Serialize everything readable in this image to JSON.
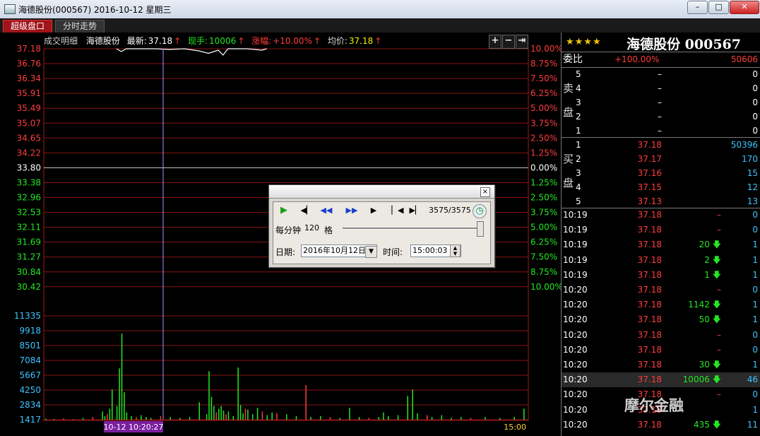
{
  "window": {
    "title": "海德股份(000567) 2016-10-12 星期三",
    "minimize": "–",
    "maximize": "□",
    "close": "✕"
  },
  "tabs": [
    {
      "label": "超级盘口"
    },
    {
      "label": "分时走势"
    }
  ],
  "infobar": {
    "detail": "成交明细",
    "name": "海德股份",
    "latest_label": "最新:",
    "latest": "37.18",
    "hand_label": "现手:",
    "hand": "10006",
    "change_label": "涨幅:",
    "change": "+10.00%",
    "avg_label": "均价:",
    "avg": "37.18"
  },
  "chart_tools": [
    "+",
    "−",
    "⇥"
  ],
  "chart_data": {
    "type": "line",
    "price_ticks": [
      {
        "v": "37.18",
        "pct": "10.00%",
        "side": "up"
      },
      {
        "v": "36.76",
        "pct": "8.75%",
        "side": "up"
      },
      {
        "v": "36.34",
        "pct": "7.50%",
        "side": "up"
      },
      {
        "v": "35.91",
        "pct": "6.25%",
        "side": "up"
      },
      {
        "v": "35.49",
        "pct": "5.00%",
        "side": "up"
      },
      {
        "v": "35.07",
        "pct": "3.75%",
        "side": "up"
      },
      {
        "v": "34.65",
        "pct": "2.50%",
        "side": "up"
      },
      {
        "v": "34.22",
        "pct": "1.25%",
        "side": "up"
      },
      {
        "v": "33.80",
        "pct": "0.00%",
        "side": "mid"
      },
      {
        "v": "33.38",
        "pct": "1.25%",
        "side": "down"
      },
      {
        "v": "32.96",
        "pct": "2.50%",
        "side": "down"
      },
      {
        "v": "32.53",
        "pct": "3.75%",
        "side": "down"
      },
      {
        "v": "32.11",
        "pct": "5.00%",
        "side": "down"
      },
      {
        "v": "31.69",
        "pct": "6.25%",
        "side": "down"
      },
      {
        "v": "31.27",
        "pct": "7.50%",
        "side": "down"
      },
      {
        "v": "30.84",
        "pct": "8.75%",
        "side": "down"
      },
      {
        "v": "30.42",
        "pct": "10.00%",
        "side": "down"
      }
    ],
    "volume_ticks": [
      "11335",
      "9918",
      "8501",
      "7084",
      "5667",
      "4250",
      "2834",
      "1417"
    ],
    "time_start": "10-12 10:20:27",
    "time_end": "15:00",
    "volume_bars": [
      [
        0.003,
        120,
        "g"
      ],
      [
        0.02,
        80,
        "g"
      ],
      [
        0.04,
        150,
        "r"
      ],
      [
        0.06,
        60,
        "g"
      ],
      [
        0.08,
        200,
        "g"
      ],
      [
        0.1,
        300,
        "r"
      ],
      [
        0.12,
        900,
        "g"
      ],
      [
        0.125,
        400,
        "g"
      ],
      [
        0.13,
        600,
        "r"
      ],
      [
        0.135,
        1200,
        "g"
      ],
      [
        0.14,
        3300,
        "g"
      ],
      [
        0.15,
        1500,
        "g"
      ],
      [
        0.155,
        5600,
        "g"
      ],
      [
        0.16,
        9400,
        "g"
      ],
      [
        0.165,
        3000,
        "g"
      ],
      [
        0.17,
        800,
        "g"
      ],
      [
        0.18,
        400,
        "g"
      ],
      [
        0.19,
        300,
        "r"
      ],
      [
        0.2,
        500,
        "g"
      ],
      [
        0.21,
        300,
        "g"
      ],
      [
        0.22,
        200,
        "g"
      ],
      [
        0.24,
        400,
        "r"
      ],
      [
        0.26,
        300,
        "g"
      ],
      [
        0.28,
        200,
        "g"
      ],
      [
        0.3,
        300,
        "g"
      ],
      [
        0.32,
        1900,
        "g"
      ],
      [
        0.335,
        600,
        "g"
      ],
      [
        0.34,
        5300,
        "g"
      ],
      [
        0.345,
        2500,
        "g"
      ],
      [
        0.35,
        1500,
        "g"
      ],
      [
        0.355,
        800,
        "r"
      ],
      [
        0.36,
        1200,
        "g"
      ],
      [
        0.365,
        1500,
        "g"
      ],
      [
        0.37,
        1000,
        "g"
      ],
      [
        0.375,
        600,
        "r"
      ],
      [
        0.38,
        900,
        "g"
      ],
      [
        0.39,
        400,
        "g"
      ],
      [
        0.4,
        5700,
        "g"
      ],
      [
        0.405,
        1600,
        "g"
      ],
      [
        0.41,
        700,
        "g"
      ],
      [
        0.415,
        1200,
        "r"
      ],
      [
        0.42,
        1100,
        "g"
      ],
      [
        0.43,
        600,
        "g"
      ],
      [
        0.44,
        1300,
        "g"
      ],
      [
        0.45,
        900,
        "r"
      ],
      [
        0.46,
        500,
        "g"
      ],
      [
        0.47,
        800,
        "g"
      ],
      [
        0.48,
        700,
        "r"
      ],
      [
        0.5,
        600,
        "g"
      ],
      [
        0.52,
        400,
        "g"
      ],
      [
        0.54,
        3800,
        "r"
      ],
      [
        0.55,
        300,
        "g"
      ],
      [
        0.57,
        400,
        "g"
      ],
      [
        0.59,
        300,
        "r"
      ],
      [
        0.61,
        200,
        "g"
      ],
      [
        0.63,
        1300,
        "g"
      ],
      [
        0.65,
        300,
        "g"
      ],
      [
        0.67,
        200,
        "r"
      ],
      [
        0.69,
        300,
        "g"
      ],
      [
        0.7,
        800,
        "g"
      ],
      [
        0.71,
        400,
        "g"
      ],
      [
        0.73,
        500,
        "g"
      ],
      [
        0.75,
        2600,
        "g"
      ],
      [
        0.76,
        3300,
        "g"
      ],
      [
        0.77,
        700,
        "g"
      ],
      [
        0.79,
        500,
        "r"
      ],
      [
        0.8,
        300,
        "g"
      ],
      [
        0.82,
        500,
        "g"
      ],
      [
        0.84,
        200,
        "g"
      ],
      [
        0.86,
        300,
        "g"
      ],
      [
        0.88,
        200,
        "r"
      ],
      [
        0.91,
        300,
        "g"
      ],
      [
        0.94,
        200,
        "g"
      ],
      [
        0.97,
        300,
        "g"
      ],
      [
        0.99,
        1200,
        "g"
      ]
    ]
  },
  "right": {
    "stars": "★★★★",
    "stock": "海德股份 000567",
    "weibi_label": "委比",
    "weibi_pct": "+100.00%",
    "weibi_val": "50606",
    "sell_label": "卖盘",
    "buy_label": "买盘",
    "sell": [
      {
        "lvl": "5",
        "price": "–",
        "vol": "0"
      },
      {
        "lvl": "4",
        "price": "–",
        "vol": "0"
      },
      {
        "lvl": "3",
        "price": "–",
        "vol": "0"
      },
      {
        "lvl": "2",
        "price": "–",
        "vol": "0"
      },
      {
        "lvl": "1",
        "price": "–",
        "vol": "0"
      }
    ],
    "buy": [
      {
        "lvl": "1",
        "price": "37.18",
        "vol": "50396"
      },
      {
        "lvl": "2",
        "price": "37.17",
        "vol": "170"
      },
      {
        "lvl": "3",
        "price": "37.16",
        "vol": "15"
      },
      {
        "lvl": "4",
        "price": "37.15",
        "vol": "12"
      },
      {
        "lvl": "5",
        "price": "37.13",
        "vol": "13"
      }
    ],
    "ticks": [
      {
        "t": "10:19",
        "p": "37.18",
        "v": "–",
        "n": "0",
        "dir": "none"
      },
      {
        "t": "10:19",
        "p": "37.18",
        "v": "–",
        "n": "0",
        "dir": "none"
      },
      {
        "t": "10:19",
        "p": "37.18",
        "v": "20",
        "n": "1",
        "dir": "down"
      },
      {
        "t": "10:19",
        "p": "37.18",
        "v": "2",
        "n": "1",
        "dir": "down"
      },
      {
        "t": "10:19",
        "p": "37.18",
        "v": "1",
        "n": "1",
        "dir": "down"
      },
      {
        "t": "10:20",
        "p": "37.18",
        "v": "–",
        "n": "0",
        "dir": "none"
      },
      {
        "t": "10:20",
        "p": "37.18",
        "v": "1142",
        "n": "1",
        "dir": "down"
      },
      {
        "t": "10:20",
        "p": "37.18",
        "v": "50",
        "n": "1",
        "dir": "down"
      },
      {
        "t": "10:20",
        "p": "37.18",
        "v": "–",
        "n": "0",
        "dir": "none"
      },
      {
        "t": "10:20",
        "p": "37.18",
        "v": "–",
        "n": "0",
        "dir": "none"
      },
      {
        "t": "10:20",
        "p": "37.18",
        "v": "30",
        "n": "1",
        "dir": "down"
      },
      {
        "t": "10:20",
        "p": "37.18",
        "v": "10006",
        "n": "46",
        "dir": "down"
      },
      {
        "t": "10:20",
        "p": "37.18",
        "v": "–",
        "n": "0",
        "dir": "none"
      },
      {
        "t": "10:20",
        "p": "37.18",
        "v": "",
        "n": "1",
        "dir": "none"
      },
      {
        "t": "10:20",
        "p": "37.18",
        "v": "435",
        "n": "11",
        "dir": "down"
      }
    ]
  },
  "replay": {
    "close": "×",
    "count": "3575/3575",
    "per_min_label": "每分钟",
    "per_min": "120",
    "unit": "格",
    "date_label": "日期:",
    "date": "2016年10月12日",
    "time_label": "时间:",
    "time": "15:00:03"
  },
  "watermark": "摩尔金融"
}
